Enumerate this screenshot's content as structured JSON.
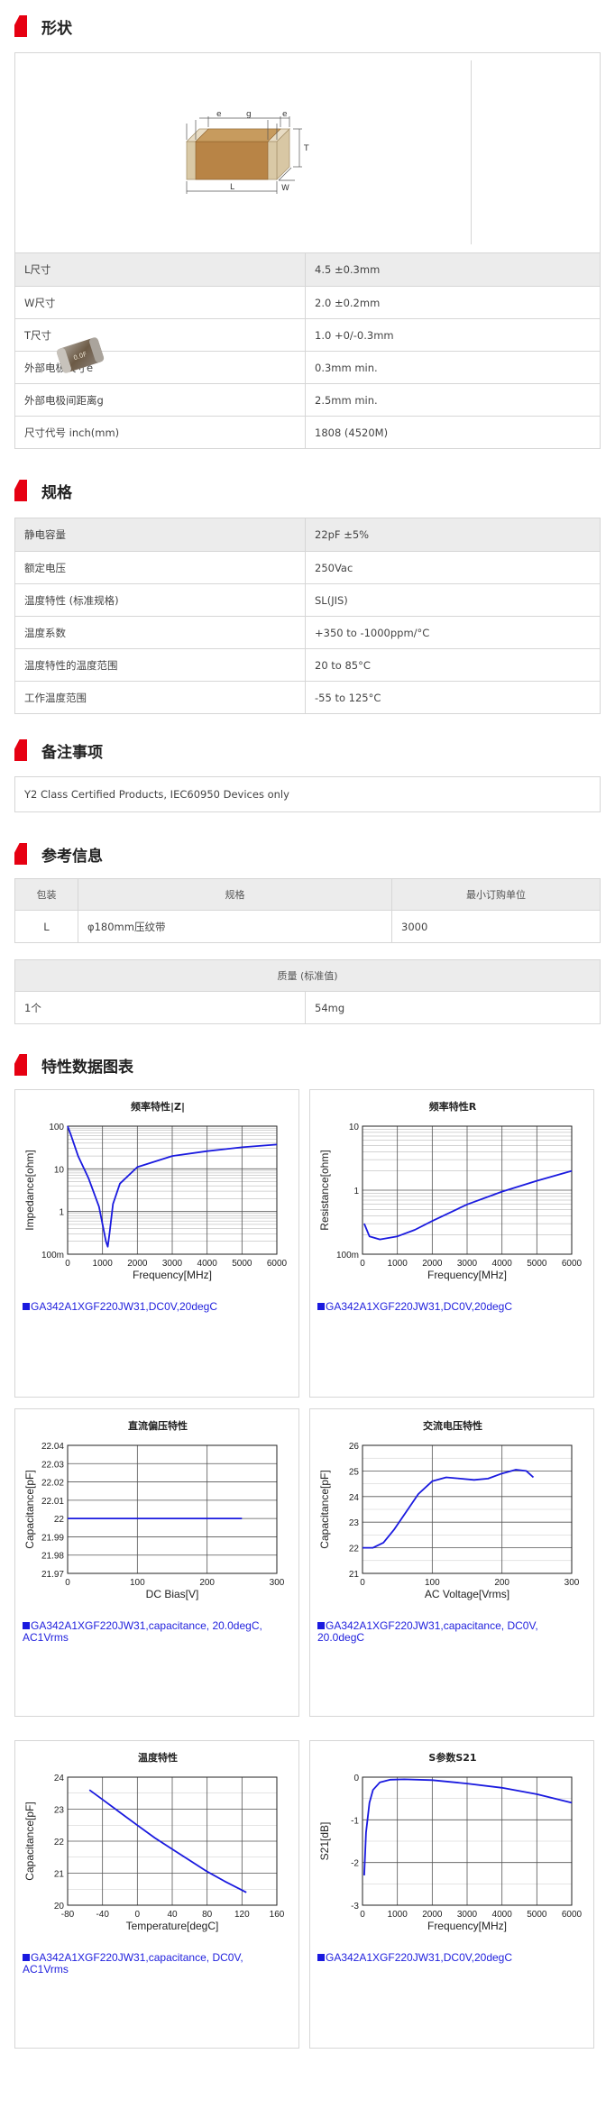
{
  "shape": {
    "title": "形状",
    "dims": {
      "e1": "e",
      "g": "g",
      "e2": "e",
      "T": "T",
      "L": "L",
      "W": "W"
    },
    "chip_label": "0.0F",
    "rows": [
      {
        "k": "L尺寸",
        "v": "4.5 ±0.3mm"
      },
      {
        "k": "W尺寸",
        "v": "2.0 ±0.2mm"
      },
      {
        "k": "T尺寸",
        "v": "1.0 +0/-0.3mm"
      },
      {
        "k": "外部电极尺寸e",
        "v": "0.3mm min."
      },
      {
        "k": "外部电极间距离g",
        "v": "2.5mm min."
      },
      {
        "k": "尺寸代号 inch(mm)",
        "v": "1808 (4520M)"
      }
    ]
  },
  "spec": {
    "title": "规格",
    "rows": [
      {
        "k": "静电容量",
        "v": "22pF ±5%"
      },
      {
        "k": "额定电压",
        "v": "250Vac"
      },
      {
        "k": "温度特性 (标准规格)",
        "v": "SL(JIS)"
      },
      {
        "k": "温度系数",
        "v": "+350 to -1000ppm/°C"
      },
      {
        "k": "温度特性的温度范围",
        "v": "20 to 85°C"
      },
      {
        "k": "工作温度范围",
        "v": "-55 to 125°C"
      }
    ]
  },
  "notes": {
    "title": "备注事项",
    "text": "Y2 Class Certified Products, IEC60950 Devices only"
  },
  "reference": {
    "title": "参考信息",
    "packaging": {
      "headers": [
        "包装",
        "规格",
        "最小订购单位"
      ],
      "row": [
        "L",
        "φ180mm压纹带",
        "3000"
      ]
    },
    "mass": {
      "header": "质量 (标准值)",
      "row": [
        "1个",
        "54mg"
      ]
    }
  },
  "charts": {
    "title": "特性数据图表",
    "colors": {
      "curve": "#1a1adf",
      "grid": "#555555",
      "accent": "#e60012"
    },
    "legend_a": "GA342A1XGF220JW31,DC0V,20degC",
    "legend_b": "GA342A1XGF220JW31,capacitance, 20.0degC, AC1Vrms",
    "legend_c": "GA342A1XGF220JW31,capacitance, DC0V, 20.0degC",
    "legend_d": "GA342A1XGF220JW31,capacitance, DC0V, AC1Vrms"
  },
  "chart_data": [
    {
      "type": "line",
      "title": "频率特性|Z|",
      "xlabel": "Frequency[MHz]",
      "ylabel": "Impedance[ohm]",
      "xlim": [
        0,
        6000
      ],
      "ylim": [
        0.1,
        100
      ],
      "yscale": "log",
      "xticks": [
        "0",
        "1000",
        "2000",
        "3000",
        "4000",
        "5000",
        "6000"
      ],
      "yticks": [
        "100m",
        "1",
        "10",
        "100"
      ],
      "series": [
        {
          "x": [
            1,
            100,
            300,
            600,
            900,
            1100,
            1150,
            1200,
            1300,
            1500,
            2000,
            3000,
            4000,
            5000,
            6000
          ],
          "y": [
            100,
            60,
            20,
            6,
            1.3,
            0.2,
            0.15,
            0.3,
            1.5,
            4.5,
            11,
            20,
            26,
            32,
            37
          ]
        }
      ],
      "grid": true
    },
    {
      "type": "line",
      "title": "频率特性R",
      "xlabel": "Frequency[MHz]",
      "ylabel": "Resistance[ohm]",
      "xlim": [
        0,
        6000
      ],
      "ylim": [
        0.1,
        10
      ],
      "yscale": "log",
      "xticks": [
        "0",
        "1000",
        "2000",
        "3000",
        "4000",
        "5000",
        "6000"
      ],
      "yticks": [
        "100m",
        "1",
        "10"
      ],
      "series": [
        {
          "x": [
            50,
            200,
            500,
            1000,
            1500,
            2000,
            3000,
            4000,
            5000,
            6000
          ],
          "y": [
            0.3,
            0.19,
            0.17,
            0.19,
            0.24,
            0.33,
            0.6,
            0.95,
            1.4,
            2.0
          ]
        }
      ],
      "grid": true
    },
    {
      "type": "line",
      "title": "直流偏压特性",
      "xlabel": "DC Bias[V]",
      "ylabel": "Capacitance[pF]",
      "xlim": [
        0,
        300
      ],
      "ylim": [
        21.97,
        22.04
      ],
      "xticks": [
        "0",
        "100",
        "200",
        "300"
      ],
      "yticks": [
        "21.97",
        "21.98",
        "21.99",
        "22",
        "22.01",
        "22.02",
        "22.03",
        "22.04"
      ],
      "series": [
        {
          "x": [
            0,
            250
          ],
          "y": [
            22.0,
            22.0
          ]
        }
      ],
      "grid": true
    },
    {
      "type": "line",
      "title": "交流电压特性",
      "xlabel": "AC Voltage[Vrms]",
      "ylabel": "Capacitance[pF]",
      "xlim": [
        0,
        300
      ],
      "ylim": [
        21,
        26
      ],
      "xticks": [
        "0",
        "100",
        "200",
        "300"
      ],
      "yticks": [
        "21",
        "22",
        "23",
        "24",
        "25",
        "26"
      ],
      "series": [
        {
          "x": [
            0,
            15,
            30,
            45,
            60,
            80,
            100,
            120,
            140,
            160,
            180,
            200,
            220,
            235,
            245
          ],
          "y": [
            22.0,
            22.0,
            22.2,
            22.7,
            23.3,
            24.1,
            24.6,
            24.75,
            24.7,
            24.65,
            24.7,
            24.9,
            25.05,
            25.0,
            24.75
          ]
        }
      ],
      "grid": true
    },
    {
      "type": "line",
      "title": "温度特性",
      "xlabel": "Temperature[degC]",
      "ylabel": "Capacitance[pF]",
      "xlim": [
        -80,
        160
      ],
      "ylim": [
        20,
        24
      ],
      "xticks": [
        "-80",
        "-40",
        "0",
        "40",
        "80",
        "120",
        "160"
      ],
      "yticks": [
        "20",
        "21",
        "22",
        "23",
        "24"
      ],
      "series": [
        {
          "x": [
            -55,
            -40,
            -20,
            0,
            20,
            40,
            60,
            80,
            100,
            125
          ],
          "y": [
            23.6,
            23.3,
            22.9,
            22.5,
            22.1,
            21.75,
            21.4,
            21.05,
            20.75,
            20.4
          ]
        }
      ],
      "grid": true
    },
    {
      "type": "line",
      "title": "S参数S21",
      "xlabel": "Frequency[MHz]",
      "ylabel": "S21[dB]",
      "xlim": [
        0,
        6000
      ],
      "ylim": [
        -3,
        0
      ],
      "xticks": [
        "0",
        "1000",
        "2000",
        "3000",
        "4000",
        "5000",
        "6000"
      ],
      "yticks": [
        "-3",
        "-2",
        "-1",
        "0"
      ],
      "series": [
        {
          "x": [
            50,
            100,
            200,
            300,
            500,
            800,
            1200,
            2000,
            3000,
            4000,
            5000,
            6000
          ],
          "y": [
            -2.3,
            -1.3,
            -0.6,
            -0.3,
            -0.12,
            -0.06,
            -0.05,
            -0.07,
            -0.15,
            -0.25,
            -0.4,
            -0.6
          ]
        }
      ],
      "grid": true
    }
  ]
}
